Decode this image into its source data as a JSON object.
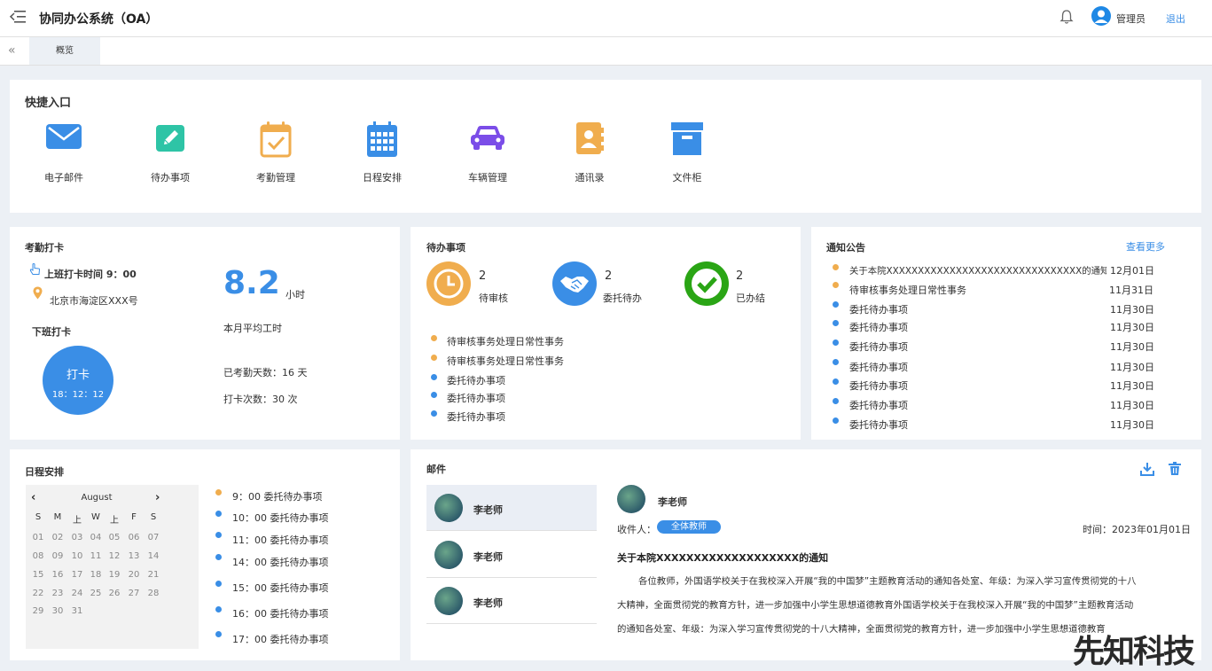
{
  "header": {
    "title": "协同办公系统（OA）",
    "user": "管理员",
    "logout": "退出"
  },
  "tabs": [
    {
      "label": "概览"
    }
  ],
  "quick_entry": {
    "title": "快捷入口",
    "items": [
      {
        "label": "电子邮件",
        "icon": "mail-icon",
        "color": "#3a8ee6"
      },
      {
        "label": "待办事项",
        "icon": "edit-icon",
        "color": "#2ec4a6"
      },
      {
        "label": "考勤管理",
        "icon": "calendar-check-icon",
        "color": "#f0ad4e"
      },
      {
        "label": "日程安排",
        "icon": "calendar-grid-icon",
        "color": "#3a8ee6"
      },
      {
        "label": "车辆管理",
        "icon": "car-icon",
        "color": "#7b4de8"
      },
      {
        "label": "通讯录",
        "icon": "contacts-icon",
        "color": "#f0ad4e"
      },
      {
        "label": "文件柜",
        "icon": "cabinet-icon",
        "color": "#3a8ee6"
      }
    ]
  },
  "attendance": {
    "title": "考勤打卡",
    "checkin_time": "上班打卡时间 9：00",
    "location": "北京市海淀区XXX号",
    "checkout_title": "下班打卡",
    "punch_label": "打卡",
    "punch_time": "18：12：12",
    "avg_hours": "8.2",
    "hours_unit": "小时",
    "avg_label": "本月平均工时",
    "days_label": "已考勤天数：16 天",
    "count_label": "打卡次数：30 次"
  },
  "todo": {
    "title": "待办事项",
    "stats": [
      {
        "count": "2",
        "label": "待审核",
        "color": "#f0ad4e",
        "icon": "clock-icon"
      },
      {
        "count": "2",
        "label": "委托待办",
        "color": "#3a8ee6",
        "icon": "handshake-icon"
      },
      {
        "count": "2",
        "label": "已办结",
        "color": "#2aa515",
        "icon": "check-icon"
      }
    ],
    "items": [
      {
        "text": "待审核事务处理日常性事务",
        "status": "orange"
      },
      {
        "text": "待审核事务处理日常性事务",
        "status": "orange"
      },
      {
        "text": "委托待办事项",
        "status": "blue"
      },
      {
        "text": "委托待办事项",
        "status": "blue"
      },
      {
        "text": "委托待办事项",
        "status": "blue"
      }
    ]
  },
  "notices": {
    "title": "通知公告",
    "more": "查看更多",
    "items": [
      {
        "text": "关于本院XXXXXXXXXXXXXXXXXXXXXXXXXXXXXXX的通知",
        "date": "12月01日",
        "status": "orange"
      },
      {
        "text": "待审核事务处理日常性事务",
        "date": "11月31日",
        "status": "orange"
      },
      {
        "text": "委托待办事项",
        "date": "11月30日",
        "status": "blue"
      },
      {
        "text": "委托待办事项",
        "date": "11月30日",
        "status": "blue"
      },
      {
        "text": "委托待办事项",
        "date": "11月30日",
        "status": "blue"
      },
      {
        "text": "委托待办事项",
        "date": "11月30日",
        "status": "blue"
      },
      {
        "text": "委托待办事项",
        "date": "11月30日",
        "status": "blue"
      },
      {
        "text": "委托待办事项",
        "date": "11月30日",
        "status": "blue"
      },
      {
        "text": "委托待办事项",
        "date": "11月30日",
        "status": "blue"
      }
    ]
  },
  "schedule": {
    "title": "日程安排",
    "month": "August",
    "weekdays": [
      "S",
      "M",
      "上",
      "W",
      "上",
      "F",
      "S"
    ],
    "days": [
      "01",
      "02",
      "03",
      "04",
      "05",
      "06",
      "07",
      "08",
      "09",
      "10",
      "11",
      "12",
      "13",
      "14",
      "15",
      "16",
      "17",
      "18",
      "19",
      "20",
      "21",
      "22",
      "23",
      "24",
      "25",
      "26",
      "27",
      "28",
      "29",
      "30",
      "31"
    ],
    "items": [
      {
        "text": "9：00  委托待办事项",
        "status": "orange"
      },
      {
        "text": "10：00  委托待办事项",
        "status": "blue"
      },
      {
        "text": "11：00  委托待办事项",
        "status": "blue"
      },
      {
        "text": "14：00  委托待办事项",
        "status": "blue"
      },
      {
        "text": "15：00  委托待办事项",
        "status": "blue"
      },
      {
        "text": "16：00  委托待办事项",
        "status": "blue"
      },
      {
        "text": "17：00  委托待办事项",
        "status": "blue"
      }
    ]
  },
  "mail": {
    "title": "邮件",
    "list": [
      {
        "name": "李老师"
      },
      {
        "name": "李老师"
      },
      {
        "name": "李老师"
      }
    ],
    "detail": {
      "sender": "李老师",
      "recipient_label": "收件人：",
      "recipient_tag": "全体教师",
      "time": "时间：2023年01月01日",
      "subject": "关于本院XXXXXXXXXXXXXXXXXXX的通知",
      "body_lines": [
        "各位教师，外国语学校关于在我校深入开展“我的中国梦”主题教育活动的通知各处室、年级：为深入学习宣传贯彻党的十八",
        "大精神，全面贯彻党的教育方针，进一步加强中小学生思想道德教育外国语学校关于在我校深入开展“我的中国梦”主题教育活动",
        "的通知各处室、年级：为深入学习宣传贯彻党的十八大精神，全面贯彻党的教育方针，进一步加强中小学生思想道德教育"
      ]
    }
  },
  "watermark": "先知科技",
  "colors": {
    "blue": "#3a8ee6",
    "orange": "#f0ad4e",
    "green": "#2aa515",
    "bg": "#ecf0f5"
  }
}
